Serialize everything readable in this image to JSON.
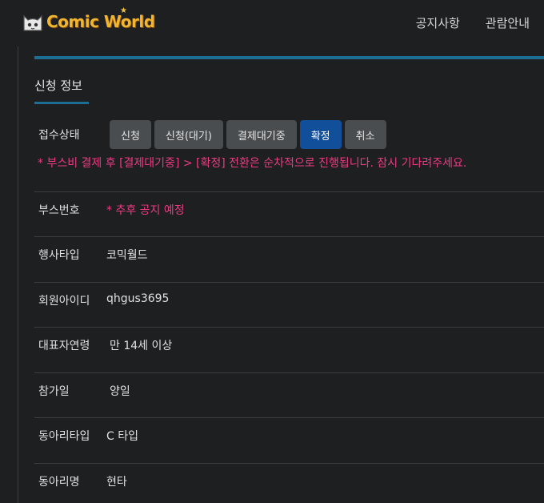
{
  "header": {
    "logo_text": "Comic World",
    "nav": [
      "공지사항",
      "관람안내"
    ]
  },
  "section": {
    "title": "신청 정보"
  },
  "status": {
    "label": "접수상태",
    "buttons": [
      {
        "label": "신청",
        "active": false
      },
      {
        "label": "신청(대기)",
        "active": false
      },
      {
        "label": "결제대기중",
        "active": false
      },
      {
        "label": "확정",
        "active": true
      },
      {
        "label": "취소",
        "active": false
      }
    ],
    "notice": "* 부스비 결제 후 [결제대기중] > [확정] 전환은 순차적으로 진행됩니다. 잠시 기다려주세요."
  },
  "fields": [
    {
      "label": "부스번호",
      "value": "* 추후 공지 예정"
    },
    {
      "label": "행사타입",
      "value": "코믹월드"
    },
    {
      "label": "회원아이디",
      "value": "qhgus3695"
    },
    {
      "label": "대표자연령",
      "value": "만 14세 이상"
    },
    {
      "label": "참가일",
      "value": "양일"
    },
    {
      "label": "동아리타입",
      "value": "C 타입"
    },
    {
      "label": "동아리명",
      "value": "현타"
    }
  ],
  "colors": {
    "accent": "#1d6f91",
    "active_button": "#114f9a",
    "notice": "#ec3b83"
  }
}
